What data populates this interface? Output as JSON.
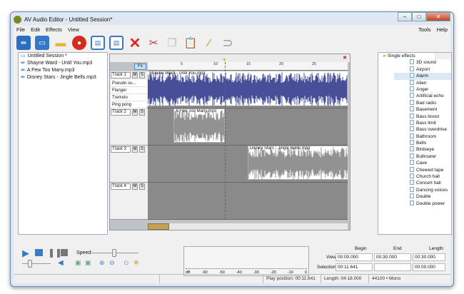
{
  "window": {
    "title": "AV Audio Editor - Untitled Session*"
  },
  "menu": {
    "items": [
      "File",
      "Edit",
      "Effects",
      "View"
    ],
    "right": [
      "Tools",
      "Help"
    ]
  },
  "toolbar": [
    "new-session-icon",
    "session-icon",
    "open-folder-icon",
    "record-icon",
    "save-icon",
    "save-as-icon",
    "delete-icon",
    "cut-icon",
    "copy-icon",
    "paste-icon",
    "magic-wand-icon",
    "undo-icon"
  ],
  "session": {
    "root": "Untitled Session *",
    "files": [
      "Shayne Ward -  Until You.mp3",
      "A Few Too Many.mp3",
      "Disney Stars - Jingle Bells.mp3"
    ]
  },
  "editor": {
    "fx_label": "Fx",
    "ruler": [
      "5",
      "10",
      "15",
      "20",
      "25"
    ],
    "tracks": [
      {
        "name": "Track 1",
        "effects": [
          "Pseudo su...",
          "Flanger",
          "Tremolo",
          "Ping pong"
        ],
        "clip": "Shayne Ward -  Until You.mp3"
      },
      {
        "name": "Track 2",
        "clip": "A Few Too Many.mp3"
      },
      {
        "name": "Track 3",
        "clip": "Disney Stars - Jingle Bellls.mp3"
      },
      {
        "name": "Track 4"
      }
    ],
    "mute": "M",
    "solo": "S"
  },
  "effects": {
    "root": "Single effects",
    "items": [
      "3D sound",
      "Airport",
      "Alarm",
      "Alien",
      "Anger",
      "Artificial echo",
      "Bad radio",
      "Basement",
      "Bass boost",
      "Bass limit",
      "Bass overdrive",
      "Bathroom",
      "Bells",
      "Birdseye",
      "Bullroarer",
      "Cave",
      "Chewed tape",
      "Church hall",
      "Concert hall",
      "Dancing voices",
      "Double",
      "Double power"
    ],
    "selected": "Alarm"
  },
  "transport": {
    "speed_label": "Speed:"
  },
  "meter": {
    "labels": [
      "dB",
      "-60",
      "-50",
      "-40",
      "-30",
      "-20",
      "-10",
      "0"
    ]
  },
  "times": {
    "headers": [
      "Begin",
      "End",
      "Length"
    ],
    "view_label": "View",
    "selection_label": "Selection",
    "view": [
      "00:00.000",
      "00:30.000",
      "00:30.000"
    ],
    "selection": [
      "00:11.641",
      "",
      "00:00.000"
    ]
  },
  "status": {
    "play": "Play position: 00:11.641",
    "length": "Length: 04:18.000",
    "format": "44100 • Mono"
  }
}
